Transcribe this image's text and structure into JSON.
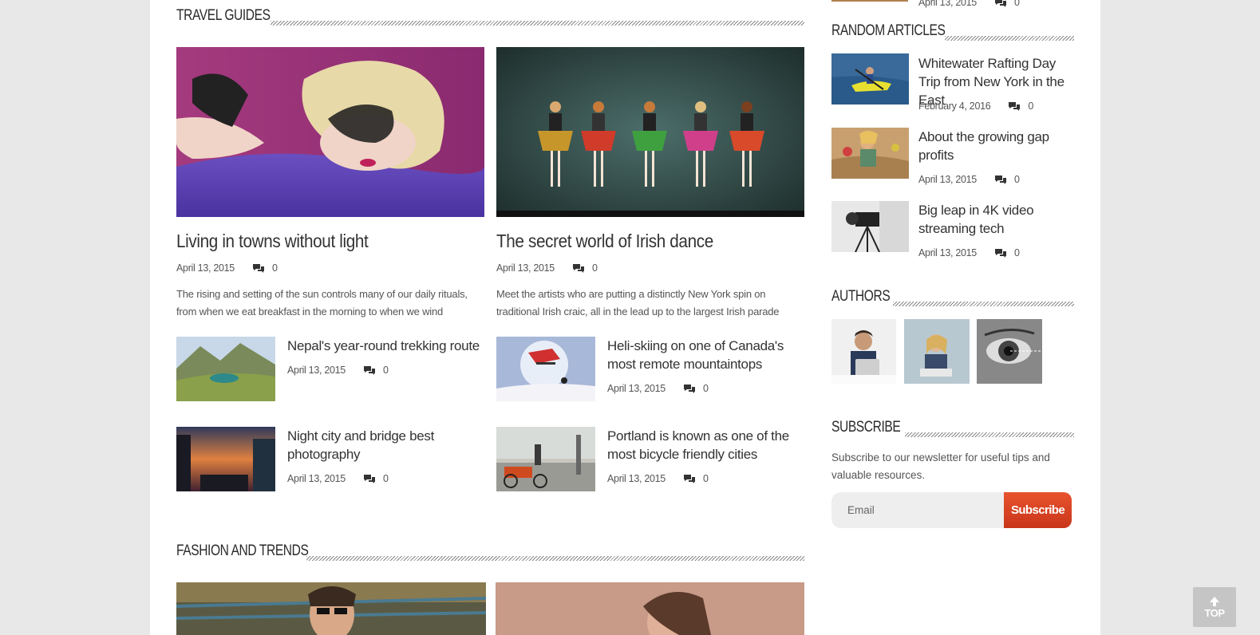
{
  "sections": {
    "travel_guides": "TRAVEL GUIDES",
    "fashion_and_trends": "FASHION AND TRENDS",
    "random_articles": "RANDOM ARTICLES",
    "authors": "AUTHORS",
    "subscribe": "SUBSCRIBE"
  },
  "top_partial_meta": {
    "date": "April 13, 2015",
    "comments": "0"
  },
  "featured": [
    {
      "title": "Living in towns without light",
      "date": "April 13, 2015",
      "comments": "0",
      "excerpt_1": "The rising and setting of the sun controls many of our daily rituals,",
      "excerpt_2": "from when we eat breakfast in the morning to when we wind"
    },
    {
      "title": "The secret world of Irish dance",
      "date": "April 13, 2015",
      "comments": "0",
      "excerpt_1": "Meet the artists who are putting a distinctly New York spin on",
      "excerpt_2": "traditional Irish craic, all in the lead up to the largest Irish parade"
    }
  ],
  "small_posts": [
    {
      "title": "Nepal's year-round trekking route",
      "date": "April 13, 2015",
      "comments": "0"
    },
    {
      "title": "Heli-skiing on one of Canada's most remote mountaintops",
      "date": "April 13, 2015",
      "comments": "0"
    },
    {
      "title": "Night city and bridge best photography",
      "date": "April 13, 2015",
      "comments": "0"
    },
    {
      "title": "Portland is known as one of the most bicycle friendly cities",
      "date": "April 13, 2015",
      "comments": "0"
    }
  ],
  "random_articles": [
    {
      "title": "Whitewater Rafting Day Trip from New York in the East",
      "date": "February 4, 2016",
      "comments": "0"
    },
    {
      "title": "About the growing gap profits",
      "date": "April 13, 2015",
      "comments": "0"
    },
    {
      "title": "Big leap in 4K video streaming tech",
      "date": "April 13, 2015",
      "comments": "0"
    }
  ],
  "subscribe": {
    "description": "Subscribe to our newsletter for useful tips and valuable resources.",
    "email_placeholder": "Email",
    "button_label": "Subscribe"
  },
  "back_to_top": "TOP",
  "colors": {
    "accent": "#d9431f",
    "page_bg": "#e8e8e8",
    "content_bg": "#ffffff"
  },
  "icons": {
    "comments": "comments-icon",
    "back_to_top": "arrow-up-icon"
  }
}
